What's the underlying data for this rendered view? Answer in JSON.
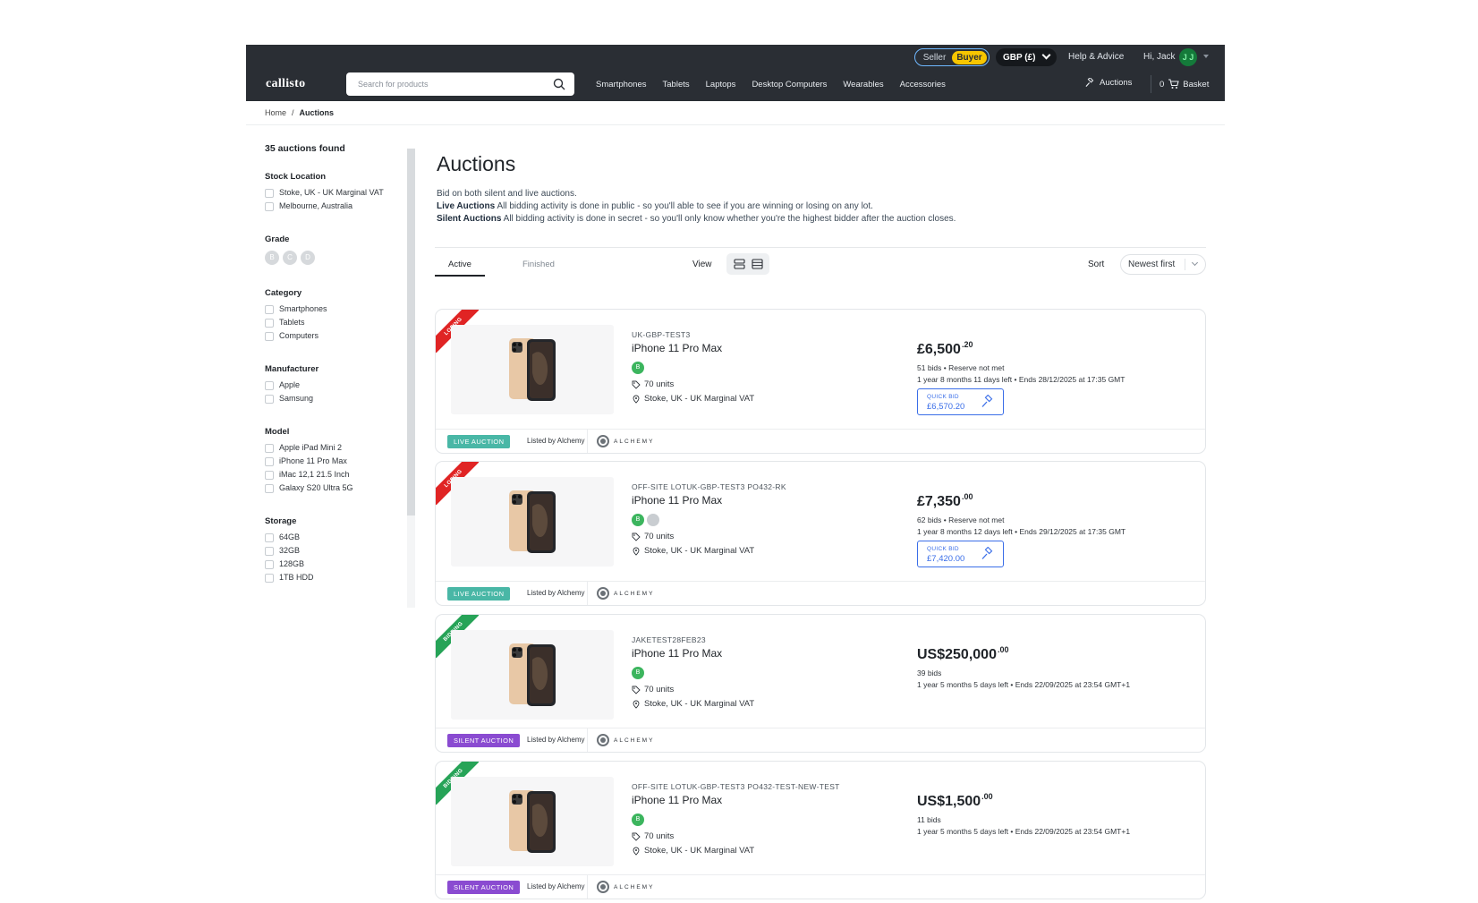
{
  "header": {
    "seller_label": "Seller",
    "buyer_label": "Buyer",
    "currency": "GBP (£)",
    "help": "Help & Advice",
    "greeting": "Hi, Jack",
    "avatar_initials": "J J",
    "logo": "callisto",
    "search_placeholder": "Search for products",
    "nav": [
      "Smartphones",
      "Tablets",
      "Laptops",
      "Desktop Computers",
      "Wearables",
      "Accessories"
    ],
    "auctions_label": "Auctions",
    "basket_count": "0",
    "basket_label": "Basket",
    "colors": {
      "bar": "#2a2e34",
      "buyer_toggle": "#f7c600",
      "avatar": "#147a3a"
    }
  },
  "breadcrumb": {
    "home": "Home",
    "separator": "/",
    "current": "Auctions"
  },
  "sidebar": {
    "found": "35 auctions found",
    "filters": {
      "stock_location": {
        "title": "Stock Location",
        "options": [
          "Stoke, UK - UK Marginal VAT",
          "Melbourne, Australia"
        ]
      },
      "grade": {
        "title": "Grade",
        "options": [
          "B",
          "C",
          "D"
        ]
      },
      "category": {
        "title": "Category",
        "options": [
          "Smartphones",
          "Tablets",
          "Computers"
        ]
      },
      "manufacturer": {
        "title": "Manufacturer",
        "options": [
          "Apple",
          "Samsung"
        ]
      },
      "model": {
        "title": "Model",
        "options": [
          "Apple iPad Mini 2",
          "iPhone 11 Pro Max",
          "iMac 12,1 21.5 Inch",
          "Galaxy S20 Ultra 5G"
        ]
      },
      "storage": {
        "title": "Storage",
        "options": [
          "64GB",
          "32GB",
          "128GB",
          "1TB HDD"
        ]
      }
    }
  },
  "main": {
    "title": "Auctions",
    "intro": "Bid on both silent and live auctions.",
    "live_title": "Live Auctions",
    "live_text": "All bidding activity is done in public - so you'll able to see if you are winning or losing on any lot.",
    "silent_title": "Silent Auctions",
    "silent_text": "All bidding activity is done in secret - so you'll only know whether you're the highest bidder after the auction closes.",
    "tabs": [
      "Active",
      "Finished"
    ],
    "view_label": "View",
    "sort_label": "Sort",
    "sort_value": "Newest first"
  },
  "auctions": [
    {
      "status": "LOSING",
      "sku": "UK-GBP-TEST3",
      "name": "iPhone 11 Pro Max",
      "grades": [
        "B"
      ],
      "units": "70 units",
      "location": "Stoke, UK - UK Marginal VAT",
      "price_main": "£6,500",
      "price_cents": ".20",
      "bids": "51 bids • Reserve not met",
      "ends": "1 year 8 months 11 days left • Ends 28/12/2025 at 17:35 GMT",
      "quickbid_label": "QUICK BID",
      "quickbid_value": "£6,570.20",
      "type": "LIVE AUCTION",
      "listed_by": "Listed by Alchemy",
      "partner": "ALCHEMY"
    },
    {
      "status": "LOSING",
      "sku": "OFF-SITE LOTUK-GBP-TEST3 PO432-RK",
      "name": "iPhone 11 Pro Max",
      "grades": [
        "B",
        ""
      ],
      "units": "70 units",
      "location": "Stoke, UK - UK Marginal VAT",
      "price_main": "£7,350",
      "price_cents": ".00",
      "bids": "62 bids • Reserve not met",
      "ends": "1 year 8 months 12 days left • Ends 29/12/2025 at 17:35 GMT",
      "quickbid_label": "QUICK BID",
      "quickbid_value": "£7,420.00",
      "type": "LIVE AUCTION",
      "listed_by": "Listed by Alchemy",
      "partner": "ALCHEMY"
    },
    {
      "status": "BIDDING",
      "sku": "JAKETEST28FEB23",
      "name": "iPhone 11 Pro Max",
      "grades": [
        "B"
      ],
      "units": "70 units",
      "location": "Stoke, UK - UK Marginal VAT",
      "price_main": "US$250,000",
      "price_cents": ".00",
      "bids": "39 bids",
      "ends": "1 year 5 months 5 days left • Ends 22/09/2025 at 23:54 GMT+1",
      "type": "SILENT AUCTION",
      "listed_by": "Listed by Alchemy",
      "partner": "ALCHEMY"
    },
    {
      "status": "BIDDING",
      "sku": "OFF-SITE LOTUK-GBP-TEST3 PO432-TEST-NEW-TEST",
      "name": "iPhone 11 Pro Max",
      "grades": [
        "B"
      ],
      "units": "70 units",
      "location": "Stoke, UK - UK Marginal VAT",
      "price_main": "US$1,500",
      "price_cents": ".00",
      "bids": "11 bids",
      "ends": "1 year 5 months 5 days left • Ends 22/09/2025 at 23:54 GMT+1",
      "type": "SILENT AUCTION",
      "listed_by": "Listed by Alchemy",
      "partner": "ALCHEMY"
    }
  ],
  "colors": {
    "losing": "#e02424",
    "bidding": "#26a357",
    "live": "#49b7a6",
    "silent": "#8a4bd1",
    "quickbid": "#3a6ee8",
    "grade_b": "#3cb55e"
  }
}
